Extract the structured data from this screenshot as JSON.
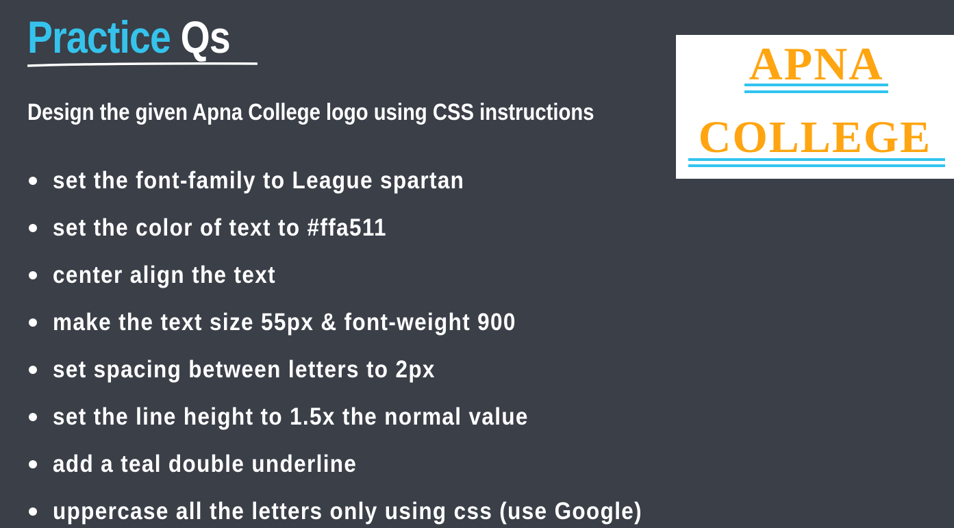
{
  "slide": {
    "title_part1": "Practice",
    "title_part2": "Qs",
    "subtitle": "Design the given Apna College logo using CSS instructions",
    "bullets": [
      "set the font-family to League spartan",
      "set the color of text to #ffa511",
      "center align the text",
      "make the text size 55px & font-weight 900",
      "set spacing between letters to 2px",
      "set the line height to 1.5x the normal value",
      "add a teal double underline",
      "uppercase all the letters only using css (use Google)"
    ]
  },
  "logo": {
    "line1": "APNA",
    "line2": "COLLEGE",
    "text_color": "#ffa511",
    "underline_color": "#31c4f0"
  },
  "colors": {
    "background": "#3a3f48",
    "title_accent": "#35c3ec"
  }
}
